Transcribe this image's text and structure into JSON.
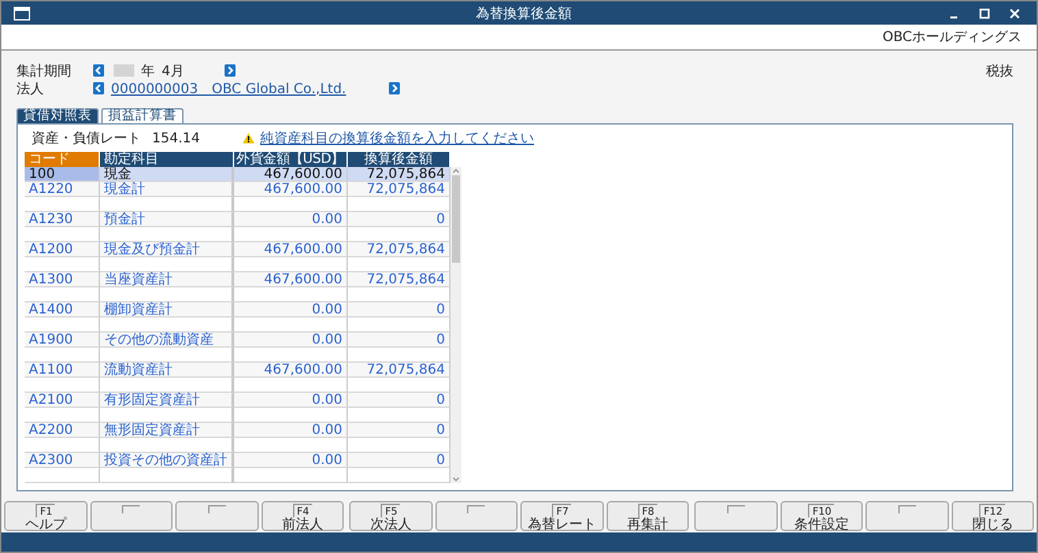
{
  "window": {
    "title": "為替換算後金額"
  },
  "company": "OBCホールディングス",
  "filters": {
    "period_label": "集計期間",
    "year_label": "年",
    "month": "4月",
    "corp_label": "法人",
    "corp_value": "0000000003　OBC Global Co.,Ltd.",
    "tax_mode": "税抜"
  },
  "tabs": [
    {
      "label": "貸借対照表",
      "selected": true
    },
    {
      "label": "損益計算書",
      "selected": false
    }
  ],
  "rate": {
    "label": "資産・負債レート",
    "value": "154.14"
  },
  "warning": "純資産科目の換算後金額を入力してください",
  "table": {
    "columns": [
      "コード",
      "勘定科目",
      "外貨金額【USD】",
      "換算後金額"
    ],
    "rows": [
      {
        "kind": "data",
        "selected": true,
        "code": "100",
        "account": "現金",
        "foreign": "467,600.00",
        "converted": "72,075,864"
      },
      {
        "kind": "data",
        "selected": false,
        "code": "A1220",
        "account": "現金計",
        "foreign": "467,600.00",
        "converted": "72,075,864"
      },
      {
        "kind": "blank"
      },
      {
        "kind": "data",
        "selected": false,
        "code": "A1230",
        "account": "預金計",
        "foreign": "0.00",
        "converted": "0"
      },
      {
        "kind": "blank"
      },
      {
        "kind": "data",
        "selected": false,
        "code": "A1200",
        "account": "現金及び預金計",
        "foreign": "467,600.00",
        "converted": "72,075,864"
      },
      {
        "kind": "blank"
      },
      {
        "kind": "data",
        "selected": false,
        "code": "A1300",
        "account": "当座資産計",
        "foreign": "467,600.00",
        "converted": "72,075,864"
      },
      {
        "kind": "blank"
      },
      {
        "kind": "data",
        "selected": false,
        "code": "A1400",
        "account": "棚卸資産計",
        "foreign": "0.00",
        "converted": "0"
      },
      {
        "kind": "blank"
      },
      {
        "kind": "data",
        "selected": false,
        "code": "A1900",
        "account": "その他の流動資産",
        "foreign": "0.00",
        "converted": "0"
      },
      {
        "kind": "blank"
      },
      {
        "kind": "data",
        "selected": false,
        "code": "A1100",
        "account": "流動資産計",
        "foreign": "467,600.00",
        "converted": "72,075,864"
      },
      {
        "kind": "blank"
      },
      {
        "kind": "data",
        "selected": false,
        "code": "A2100",
        "account": "有形固定資産計",
        "foreign": "0.00",
        "converted": "0"
      },
      {
        "kind": "blank"
      },
      {
        "kind": "data",
        "selected": false,
        "code": "A2200",
        "account": "無形固定資産計",
        "foreign": "0.00",
        "converted": "0"
      },
      {
        "kind": "blank"
      },
      {
        "kind": "data",
        "selected": false,
        "code": "A2300",
        "account": "投資その他の資産計",
        "foreign": "0.00",
        "converted": "0"
      },
      {
        "kind": "blank"
      }
    ]
  },
  "function_keys": [
    {
      "kind": "key",
      "key": "F1",
      "label": "ヘルプ"
    },
    {
      "kind": "empty"
    },
    {
      "kind": "empty"
    },
    {
      "kind": "key",
      "key": "F4",
      "label": "前法人"
    },
    {
      "kind": "key",
      "key": "F5",
      "label": "次法人"
    },
    {
      "kind": "empty"
    },
    {
      "kind": "key",
      "key": "F7",
      "label": "為替レート"
    },
    {
      "kind": "key",
      "key": "F8",
      "label": "再集計"
    },
    {
      "kind": "empty"
    },
    {
      "kind": "key",
      "key": "F10",
      "label": "条件設定"
    },
    {
      "kind": "empty"
    },
    {
      "kind": "key",
      "key": "F12",
      "label": "閉じる"
    }
  ]
}
